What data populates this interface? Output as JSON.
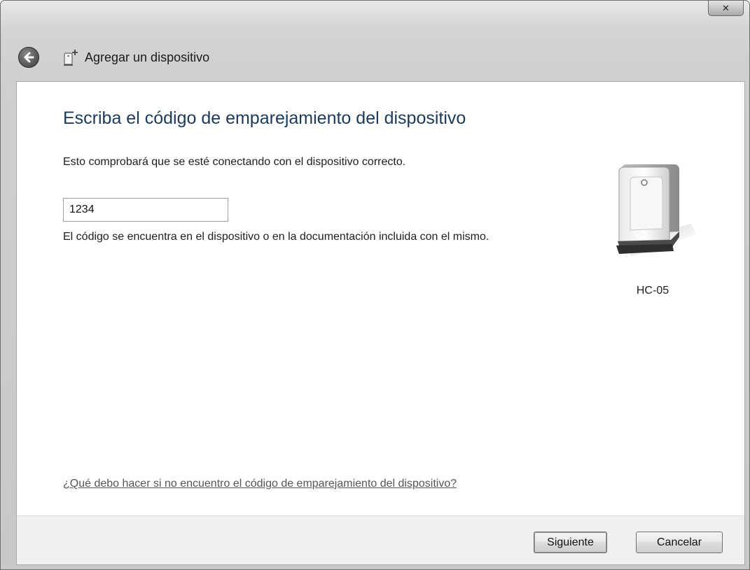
{
  "window": {
    "title": "Agregar un dispositivo",
    "close_glyph": "✕"
  },
  "main": {
    "heading": "Escriba el código de emparejamiento del dispositivo",
    "description": "Esto comprobará que se esté conectando con el dispositivo correcto.",
    "code_value": "1234",
    "hint": "El código se encuentra en el dispositivo o en la documentación incluida con el mismo.",
    "device_name": "HC-05",
    "help_link": "¿Qué debo hacer si no encuentro el código de emparejamiento del dispositivo?"
  },
  "footer": {
    "next_label": "Siguiente",
    "cancel_label": "Cancelar"
  },
  "icons": {
    "back": "back-arrow-icon",
    "title": "add-device-icon",
    "device": "bluetooth-device-icon"
  }
}
